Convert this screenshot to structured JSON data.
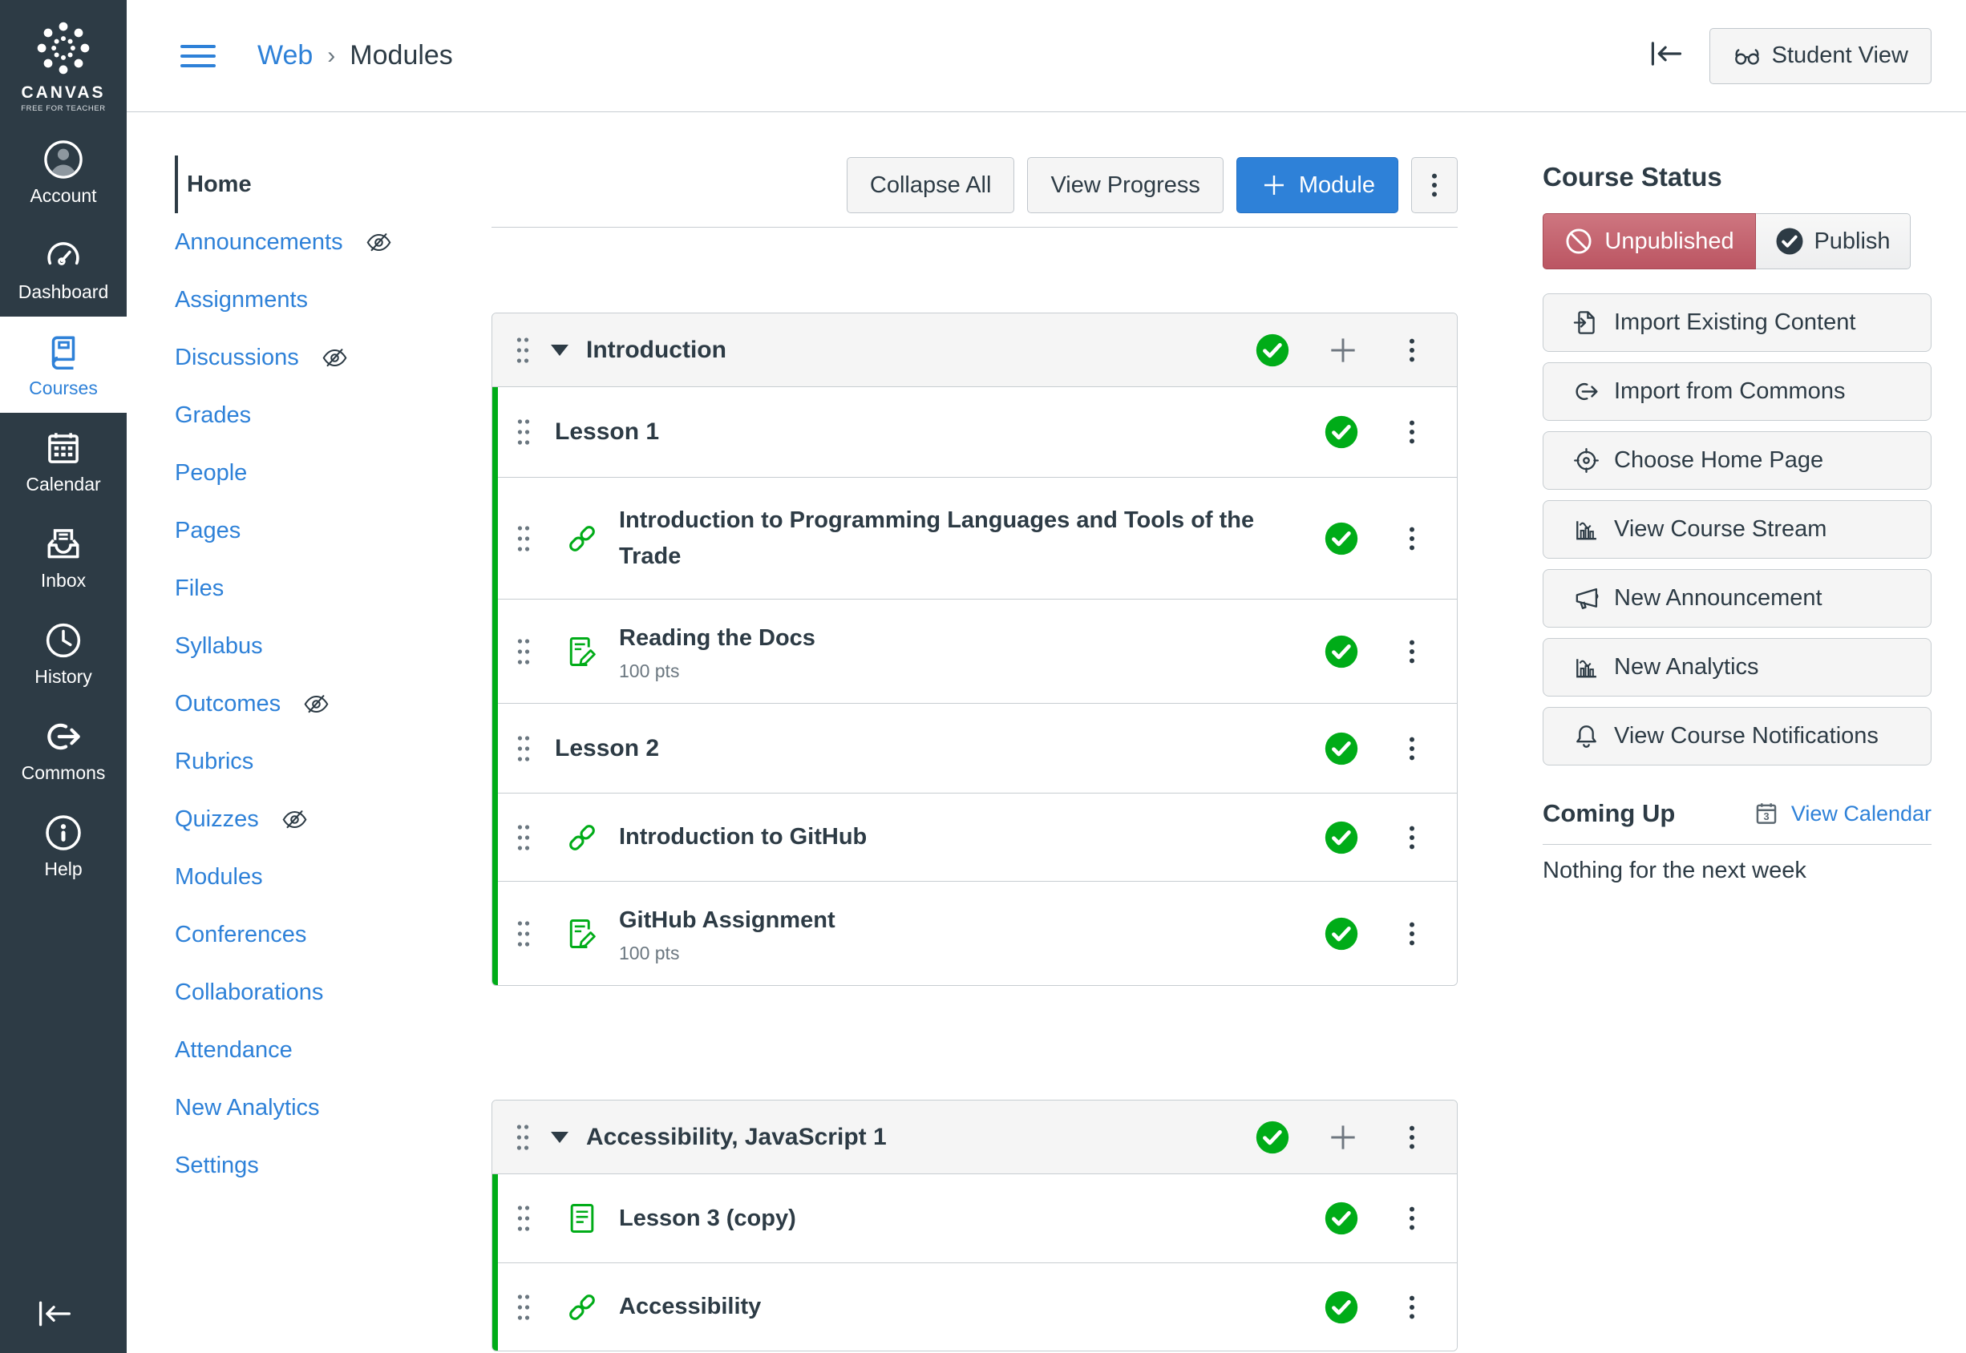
{
  "global_nav": {
    "logo_text": "CANVAS",
    "logo_subtext": "FREE FOR TEACHER",
    "items": [
      {
        "label": "Account",
        "icon": "avatar-icon"
      },
      {
        "label": "Dashboard",
        "icon": "dashboard-gauge-icon"
      },
      {
        "label": "Courses",
        "icon": "book-icon",
        "active": true
      },
      {
        "label": "Calendar",
        "icon": "calendar-icon"
      },
      {
        "label": "Inbox",
        "icon": "inbox-icon"
      },
      {
        "label": "History",
        "icon": "clock-icon"
      },
      {
        "label": "Commons",
        "icon": "share-arrow-icon"
      },
      {
        "label": "Help",
        "icon": "help-icon"
      }
    ]
  },
  "header": {
    "breadcrumb": {
      "course": "Web",
      "separator": "›",
      "page": "Modules"
    },
    "student_view": {
      "label": "Student View",
      "icon": "glasses-icon"
    },
    "collapse_icon": "collapse-left-icon"
  },
  "course_nav": {
    "items": [
      {
        "label": "Home",
        "active": true,
        "hidden": false
      },
      {
        "label": "Announcements",
        "hidden": true
      },
      {
        "label": "Assignments",
        "hidden": false
      },
      {
        "label": "Discussions",
        "hidden": true
      },
      {
        "label": "Grades",
        "hidden": false
      },
      {
        "label": "People",
        "hidden": false
      },
      {
        "label": "Pages",
        "hidden": false
      },
      {
        "label": "Files",
        "hidden": false
      },
      {
        "label": "Syllabus",
        "hidden": false
      },
      {
        "label": "Outcomes",
        "hidden": true
      },
      {
        "label": "Rubrics",
        "hidden": false
      },
      {
        "label": "Quizzes",
        "hidden": true
      },
      {
        "label": "Modules",
        "hidden": false
      },
      {
        "label": "Conferences",
        "hidden": false
      },
      {
        "label": "Collaborations",
        "hidden": false
      },
      {
        "label": "Attendance",
        "hidden": false
      },
      {
        "label": "New Analytics",
        "hidden": false
      },
      {
        "label": "Settings",
        "hidden": false
      }
    ]
  },
  "toolbar": {
    "collapse_all_label": "Collapse All",
    "view_progress_label": "View Progress",
    "add_module_label": "Module",
    "add_module_icon": "plus-icon",
    "more_icon": "kebab-icon"
  },
  "modules": [
    {
      "title": "Introduction",
      "published": true,
      "items": [
        {
          "type": "subheader",
          "title": "Lesson 1"
        },
        {
          "type": "link",
          "title": "Introduction to Programming Languages and Tools of the Trade",
          "icon": "link-icon"
        },
        {
          "type": "assignment",
          "title": "Reading the Docs",
          "subtitle": "100 pts",
          "icon": "assignment-icon"
        },
        {
          "type": "subheader",
          "title": "Lesson 2"
        },
        {
          "type": "link",
          "title": "Introduction to GitHub",
          "icon": "link-icon"
        },
        {
          "type": "assignment",
          "title": "GitHub Assignment",
          "subtitle": "100 pts",
          "icon": "assignment-icon"
        }
      ]
    },
    {
      "title": "Accessibility, JavaScript 1",
      "published": true,
      "items": [
        {
          "type": "page",
          "title": "Lesson 3 (copy)",
          "icon": "page-icon"
        },
        {
          "type": "link",
          "title": "Accessibility",
          "icon": "link-icon"
        }
      ]
    }
  ],
  "course_status": {
    "title": "Course Status",
    "unpublished_label": "Unpublished",
    "unpublished_icon": "no-symbol-icon",
    "publish_label": "Publish",
    "publish_icon": "check-filled-icon",
    "actions": [
      {
        "label": "Import Existing Content",
        "icon": "import-content-icon"
      },
      {
        "label": "Import from Commons",
        "icon": "commons-import-icon"
      },
      {
        "label": "Choose Home Page",
        "icon": "target-icon"
      },
      {
        "label": "View Course Stream",
        "icon": "analytics-chart-icon"
      },
      {
        "label": "New Announcement",
        "icon": "megaphone-icon"
      },
      {
        "label": "New Analytics",
        "icon": "analytics-chart-icon"
      },
      {
        "label": "View Course Notifications",
        "icon": "bell-icon"
      }
    ]
  },
  "coming_up": {
    "title": "Coming Up",
    "view_calendar_label": "View Calendar",
    "calendar_icon": "calendar-3-icon",
    "empty_text": "Nothing for the next week"
  },
  "colors": {
    "accent_blue": "#2E81D8",
    "publish_green": "#00AC18",
    "dark_text": "#2D3B45",
    "unpublished_red": "#BB5562",
    "border_gray": "#C7CDD1"
  }
}
